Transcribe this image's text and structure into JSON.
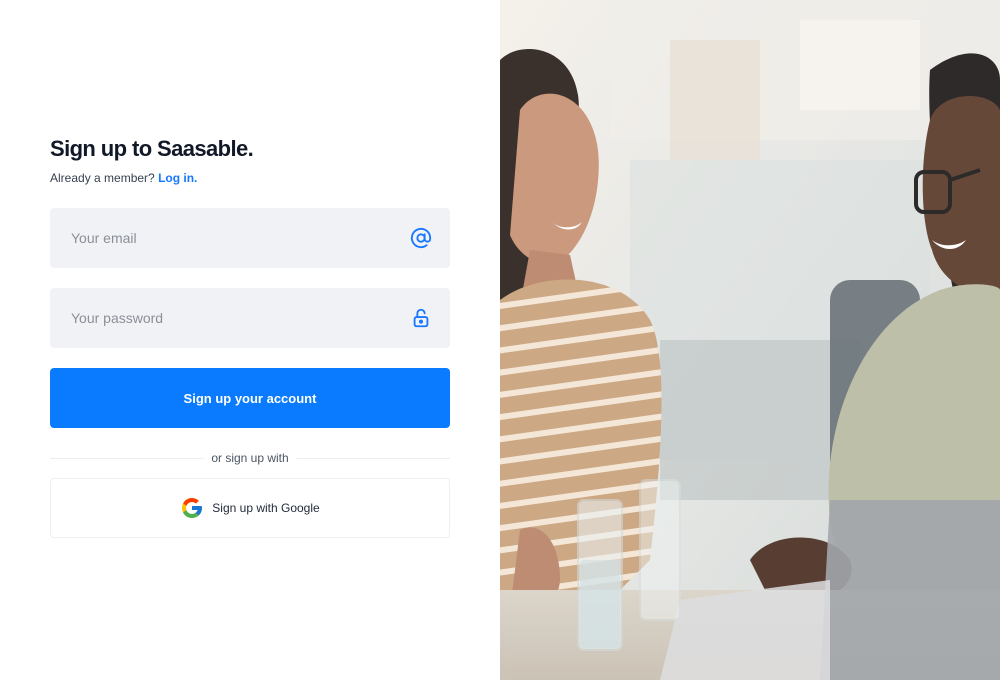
{
  "signup": {
    "title": "Sign up to Saasable.",
    "member_prompt": "Already a member?",
    "login_link": "Log in.",
    "email": {
      "placeholder": "Your email",
      "value": "",
      "icon": "at-sign-icon"
    },
    "password": {
      "placeholder": "Your password",
      "value": "",
      "icon": "lock-icon"
    },
    "submit_label": "Sign up your account",
    "divider_text": "or sign up with",
    "google_label": "Sign up with Google",
    "google_icon": "google-icon"
  },
  "hero": {
    "description_icon": "photo"
  },
  "colors": {
    "accent": "#0a7bff",
    "field_bg": "#f1f2f5",
    "heading": "#111827"
  }
}
